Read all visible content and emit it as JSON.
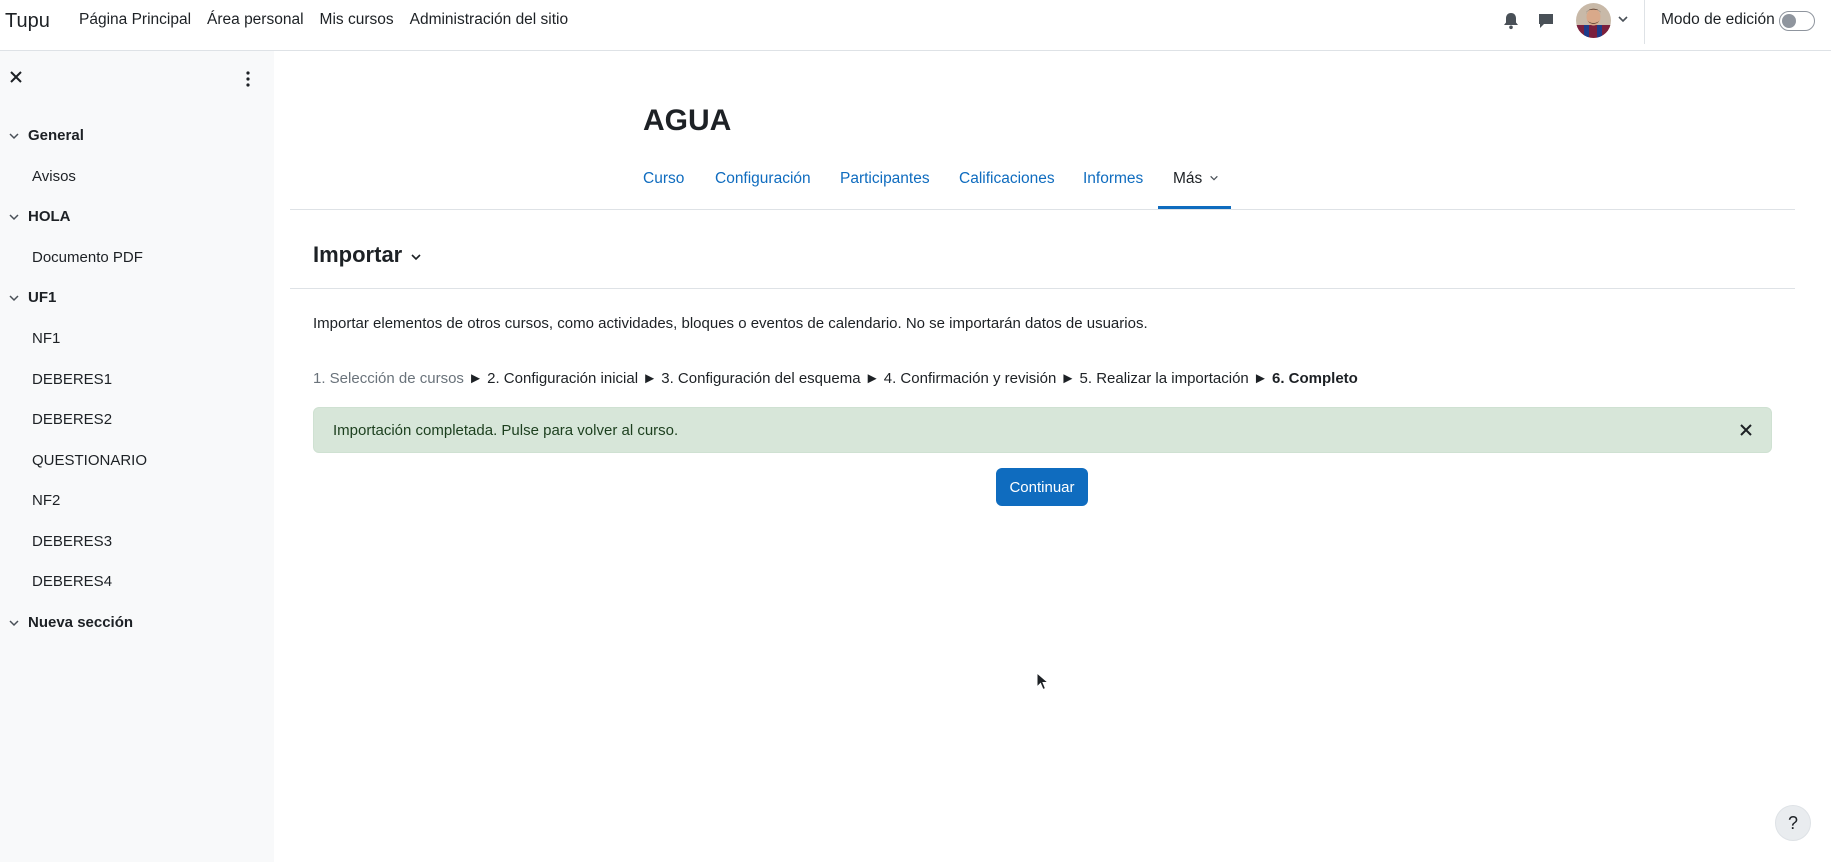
{
  "navbar": {
    "brand": "Tupu",
    "links": [
      "Página Principal",
      "Área personal",
      "Mis cursos",
      "Administración del sitio"
    ],
    "edit_mode_label": "Modo de edición",
    "edit_mode_on": false,
    "icons": [
      "bell-icon",
      "chat-icon",
      "user-avatar",
      "chevron-down-icon"
    ]
  },
  "drawer": {
    "sections": [
      {
        "title": "General",
        "items": [
          "Avisos"
        ]
      },
      {
        "title": "HOLA",
        "items": [
          "Documento PDF"
        ]
      },
      {
        "title": "UF1",
        "items": [
          "NF1",
          "DEBERES1",
          "DEBERES2",
          "QUESTIONARIO",
          "NF2",
          "DEBERES3",
          "DEBERES4"
        ]
      },
      {
        "title": "Nueva sección",
        "items": []
      }
    ]
  },
  "course": {
    "title": "AGUA",
    "tabs": [
      "Curso",
      "Configuración",
      "Participantes",
      "Calificaciones",
      "Informes",
      "Más"
    ],
    "active_tab": "Más"
  },
  "page": {
    "heading": "Importar",
    "intro": "Importar elementos de otros cursos, como actividades, bloques o eventos de calendario. No se importarán datos de usuarios.",
    "steps": {
      "s1": "1. Selección de cursos",
      "s2": "2. Configuración inicial",
      "s3": "3. Configuración del esquema",
      "s4": "4. Confirmación y revisión",
      "s5": "5. Realizar la importación",
      "s6": "6. Completo",
      "separator": "►"
    },
    "alert": "Importación completada. Pulse para volver al curso.",
    "continue_button": "Continuar"
  },
  "help_label": "?",
  "colors": {
    "primary": "#0f6cbf",
    "alert_bg": "#d7e6d9",
    "drawer_bg": "#f8f9fa"
  }
}
